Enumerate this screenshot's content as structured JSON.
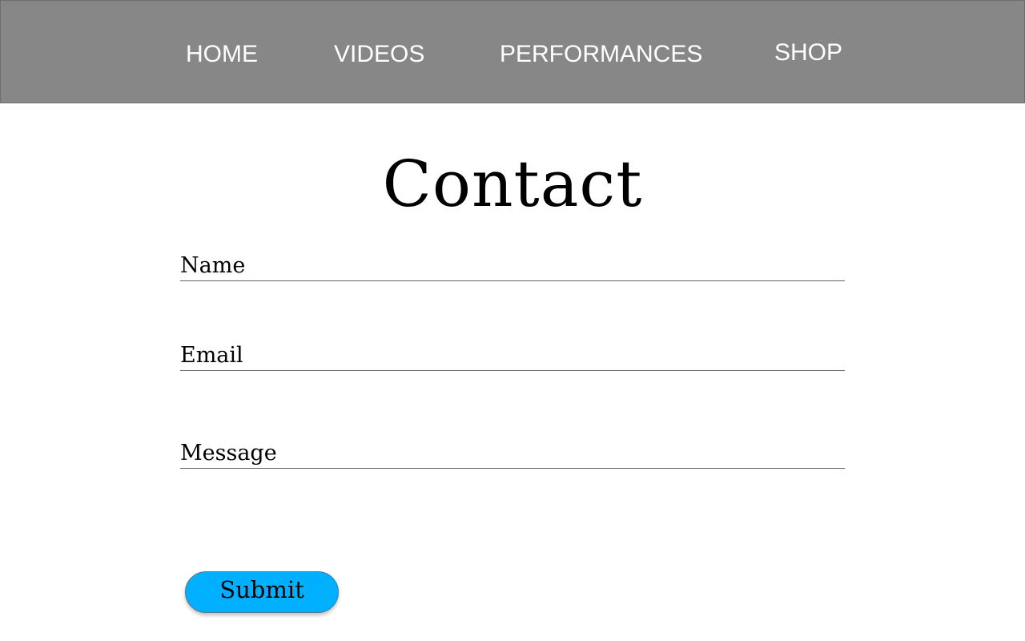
{
  "nav": {
    "items": [
      {
        "label": "HOME"
      },
      {
        "label": "VIDEOS"
      },
      {
        "label": "PERFORMANCES"
      },
      {
        "label": "SHOP"
      }
    ]
  },
  "page": {
    "title": "Contact"
  },
  "form": {
    "name_label": "Name",
    "email_label": "Email",
    "message_label": "Message",
    "submit_label": "Submit"
  },
  "colors": {
    "nav_background": "#878787",
    "submit_background": "#00b0ff"
  }
}
